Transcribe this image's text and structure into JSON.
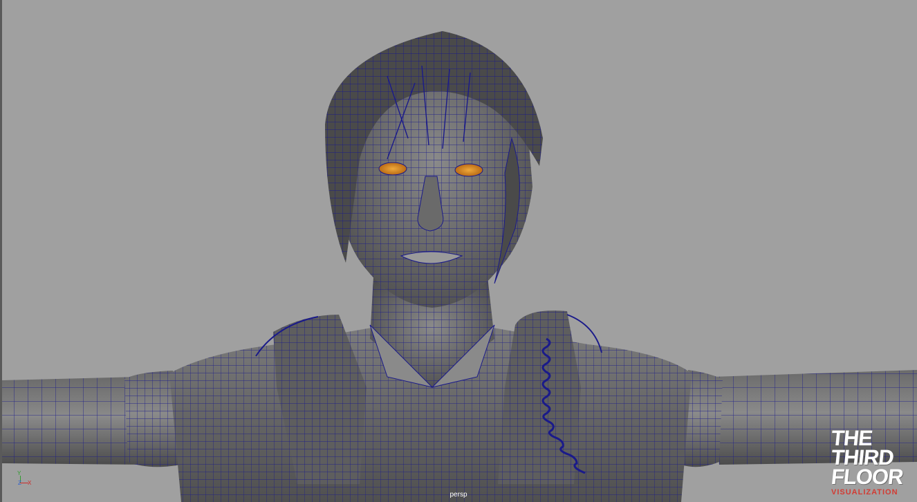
{
  "viewport": {
    "camera_label": "persp",
    "background_color": "#a0a0a0",
    "wire_color": "#1a1a8a",
    "eye_color": "#e0942a"
  },
  "axis_gizmo": {
    "y_label": "Y",
    "z_label": "Z",
    "x_label": "X"
  },
  "watermark": {
    "line1": "THE",
    "line2": "THIRD",
    "line3": "FLOOR",
    "subtitle": "VISUALIZATION"
  }
}
